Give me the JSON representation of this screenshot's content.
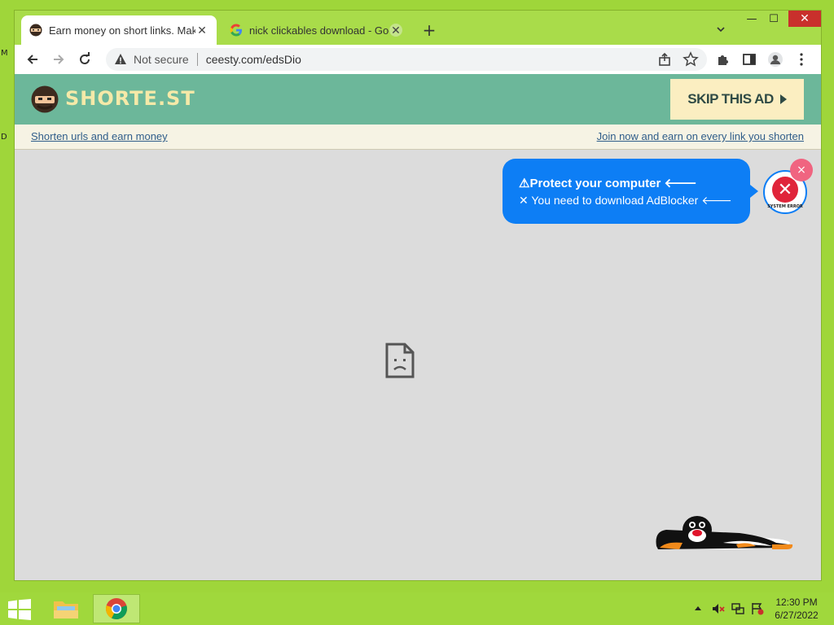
{
  "desktop": {
    "edge_letters": [
      "M",
      "D"
    ]
  },
  "browser": {
    "tabs": [
      {
        "title": "Earn money on short links. Make",
        "active": true,
        "icon": "shortest-mascot-favicon"
      },
      {
        "title": "nick clickables download - Googl",
        "active": false,
        "icon": "google-g-favicon"
      }
    ],
    "new_tab": "+",
    "window_controls": {
      "minimize": "—",
      "maximize": "☐",
      "close": "✕"
    },
    "address": {
      "security_label": "Not secure",
      "url": "ceesty.com/edsDio"
    }
  },
  "page": {
    "logo_text": "SHORTE.ST",
    "skip_button": "SKIP THIS AD",
    "left_link": "Shorten urls and earn money",
    "right_link": "Join now and earn on every link you shorten",
    "ad": {
      "line1": "⚠Protect your computer 🡐",
      "line2": "✕ You need to download AdBlocker 🡐",
      "badge_label": "SYSTEM ERROR",
      "close": "×"
    },
    "colors": {
      "header": "#6cb79a",
      "skip_bg": "#fbeec1",
      "ad_blue": "#0d7ef5",
      "page_bg": "#dcdcdc"
    }
  },
  "taskbar": {
    "clock_time": "12:30 PM",
    "clock_date": "6/27/2022",
    "tray_icons": [
      "show-hidden-icons",
      "volume-muted-icon",
      "network-icon",
      "action-center-flag-icon"
    ]
  }
}
